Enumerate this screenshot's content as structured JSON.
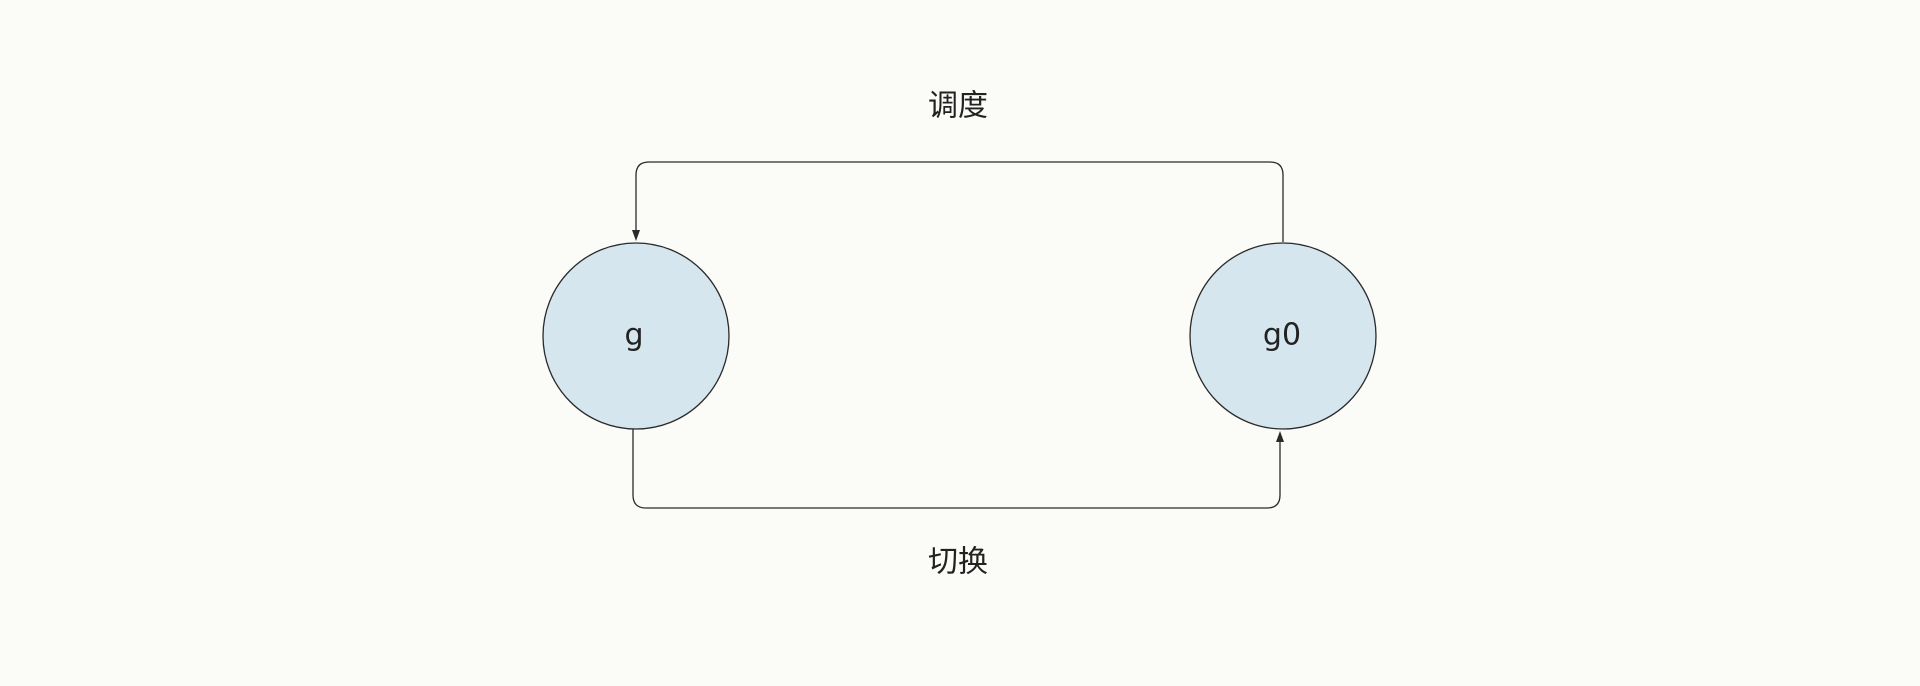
{
  "diagram": {
    "nodes": [
      {
        "id": "g",
        "label": "g"
      },
      {
        "id": "g0",
        "label": "g0"
      }
    ],
    "edges": [
      {
        "from": "g0",
        "to": "g",
        "label": "调度"
      },
      {
        "from": "g",
        "to": "g0",
        "label": "切换"
      }
    ],
    "colors": {
      "background": "#fbfbf8",
      "node_fill": "#d5e6ef",
      "stroke": "#2a2a2a"
    }
  }
}
